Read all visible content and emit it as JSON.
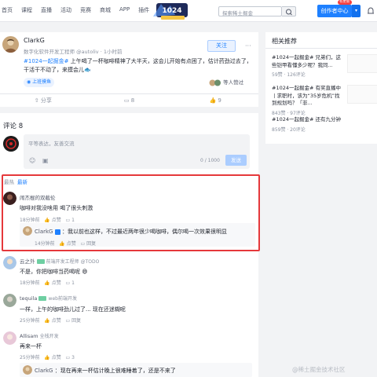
{
  "nav": [
    "首页",
    "课程",
    "直播",
    "活动",
    "竞赛",
    "商城",
    "APP",
    "插件"
  ],
  "search": {
    "placeholder": "探索稀土掘金"
  },
  "header": {
    "create_label": "创作者中心",
    "new_badge": "有更新"
  },
  "post": {
    "author": "ClarkG",
    "meta": "数字化软件开发工程师 @autoliv · 1小时前",
    "follow_label": "关注",
    "tag": "#1024一起掘金#",
    "text": " 上午喝了一杯咖啡精神了大半天，这会儿开始有点困了，估计药劲过去了，干活干不动了，来摸会儿🐟",
    "circle": "上班摸鱼",
    "like_tag": "等人赞过",
    "share": "分享",
    "comments": "8",
    "likes": "9"
  },
  "comments_section": {
    "title": "评论 8",
    "placeholder": "平等表达，友善交流",
    "count": "0 / 1000",
    "send": "发送",
    "sort_hot": "最热",
    "sort_new": "最新"
  },
  "comments": [
    {
      "name": "闹杰棍的双截伦",
      "text": "咖啡对我没啥用 喝了很头刺激",
      "time": "18分钟前",
      "likes": "点赞",
      "replies": "1"
    },
    {
      "name": "ClarkG",
      "author_tag": "作者",
      "text": "：我以前也这样，不过最近两年很少喝咖啡，偶尔喝一次效果很明显",
      "time": "14分钟前",
      "likes": "点赞",
      "replies": "回复"
    },
    {
      "name": "云之外",
      "title": "前端开发工程师 @TODO",
      "text": "不是，你把咖啡当药喝呢 😄",
      "time": "18分钟前",
      "likes": "点赞",
      "replies": "1"
    },
    {
      "name": "tequila",
      "title": "web前端开发",
      "text": "一样，上午的咖啡劲儿过了... 现在还迷糊呢",
      "time": "25分钟前",
      "likes": "点赞",
      "replies": "回复"
    },
    {
      "name": "Allisam",
      "title": "全栈开发",
      "text": "再来一杯",
      "time": "25分钟前",
      "likes": "点赞",
      "replies": "3"
    },
    {
      "name": "ClarkG",
      "text": "：现在再来一杯估计晚上很难睡着了，还是不来了",
      "time": "",
      "likes": "",
      "replies": ""
    }
  ],
  "sidebar": {
    "title": "相关推荐",
    "items": [
      {
        "text": "#1024一起掘金# 兄弟们，这些铠甲看懂多少呢？我同...",
        "stats": "59赞 · 126评论"
      },
      {
        "text": "#1024一起掘金# 有奖直播中丨求职时，该为“35岁危机”找到规划吗？「非...",
        "stats": "843赞 · 97评论"
      },
      {
        "text": "#1024一起掘金# 还有九分钟",
        "stats": "859赞 · 20评论"
      }
    ]
  },
  "watermark": "@稀土掘金技术社区"
}
